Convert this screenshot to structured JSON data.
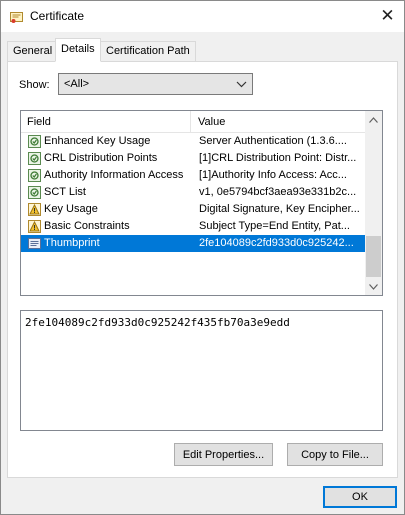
{
  "window": {
    "title": "Certificate",
    "close_glyph": "✕"
  },
  "tabs": [
    {
      "label": "General",
      "active": false
    },
    {
      "label": "Details",
      "active": true
    },
    {
      "label": "Certification Path",
      "active": false
    }
  ],
  "details": {
    "show_label": "Show:",
    "show_value": "<All>",
    "columns": {
      "field": "Field",
      "value": "Value"
    },
    "rows": [
      {
        "field": "Enhanced Key Usage",
        "value": "Server Authentication (1.3.6....",
        "icon": "extension-icon",
        "selected": false
      },
      {
        "field": "CRL Distribution Points",
        "value": "[1]CRL Distribution Point: Distr...",
        "icon": "extension-icon",
        "selected": false
      },
      {
        "field": "Authority Information Access",
        "value": "[1]Authority Info Access: Acc...",
        "icon": "extension-icon",
        "selected": false
      },
      {
        "field": "SCT List",
        "value": "v1, 0e5794bcf3aea93e331b2c...",
        "icon": "extension-icon",
        "selected": false
      },
      {
        "field": "Key Usage",
        "value": "Digital Signature, Key Encipher...",
        "icon": "critical-extension-icon",
        "selected": false
      },
      {
        "field": "Basic Constraints",
        "value": "Subject Type=End Entity, Pat...",
        "icon": "critical-extension-icon",
        "selected": false
      },
      {
        "field": "Thumbprint",
        "value": "2fe104089c2fd933d0c925242...",
        "icon": "property-icon",
        "selected": true
      }
    ],
    "value_text": "2fe104089c2fd933d0c925242f435fb70a3e9edd"
  },
  "buttons": {
    "edit_properties": "Edit Properties...",
    "copy_to_file": "Copy to File...",
    "ok": "OK"
  },
  "colors": {
    "selection": "#0078d7",
    "accent_border": "#0078d7",
    "dialog_bg": "#f0f0f0"
  }
}
